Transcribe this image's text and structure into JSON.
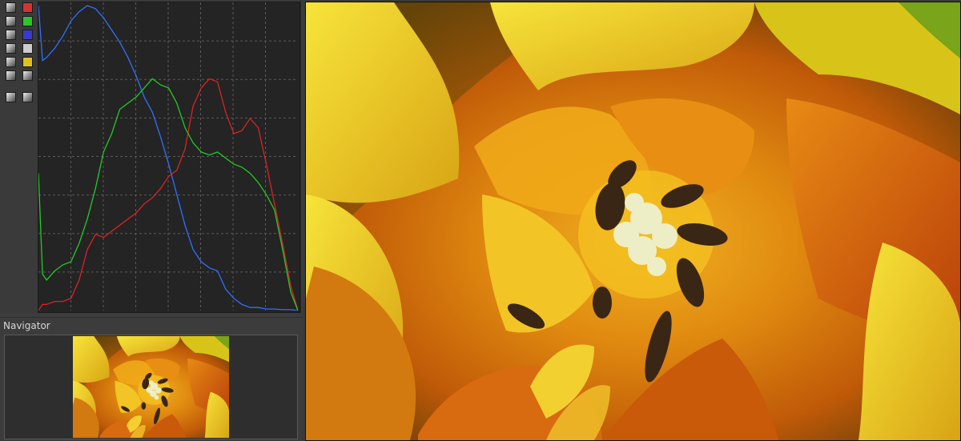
{
  "navigator": {
    "title": "Navigator"
  },
  "histogram": {
    "toolbar_buttons": [
      {
        "name": "histogram-full-icon"
      },
      {
        "name": "red-channel-toggle",
        "color": "#d63232"
      },
      {
        "name": "rgb-bar-icon"
      },
      {
        "name": "green-channel-toggle",
        "color": "#2ec42e"
      },
      {
        "name": "chroma-icon"
      },
      {
        "name": "blue-channel-toggle",
        "color": "#3a3ad0"
      },
      {
        "name": "luminance-curve-icon"
      },
      {
        "name": "luminance-toggle",
        "color": "#cccccc"
      },
      {
        "name": "raw-histogram-icon"
      },
      {
        "name": "chromaticity-toggle",
        "color": "#e0c020"
      },
      {
        "name": "crosshair-icon"
      },
      {
        "name": "gradient-icon"
      },
      {
        "name": "expand-icon"
      },
      {
        "name": "bar-display-icon"
      }
    ]
  },
  "chart_data": {
    "type": "line",
    "title": "",
    "xlabel": "",
    "ylabel": "",
    "xlim": [
      0,
      255
    ],
    "ylim": [
      0,
      100
    ],
    "grid": true,
    "x": [
      0,
      4,
      8,
      16,
      24,
      32,
      40,
      48,
      56,
      64,
      72,
      80,
      88,
      96,
      104,
      112,
      120,
      128,
      136,
      144,
      152,
      160,
      168,
      176,
      184,
      192,
      200,
      208,
      216,
      224,
      232,
      240,
      248,
      255
    ],
    "series": [
      {
        "color": "#3070ff",
        "values": [
          100,
          82,
          83,
          86,
          90,
          95,
          98,
          100,
          99,
          96,
          92,
          88,
          83,
          77,
          70,
          65,
          57,
          48,
          38,
          28,
          20,
          16,
          14,
          13,
          7,
          4,
          2,
          1,
          1,
          0.5,
          0.5,
          0.3,
          0.3,
          0
        ]
      },
      {
        "color": "#dd2222",
        "values": [
          0,
          2,
          2,
          3,
          3,
          4,
          10,
          20,
          25,
          24,
          26,
          28,
          30,
          32,
          35,
          37,
          40,
          44,
          46,
          53,
          67,
          73,
          76,
          75,
          65,
          58,
          59,
          63,
          60,
          48,
          35,
          22,
          8,
          0
        ]
      },
      {
        "color": "#22cc22",
        "values": [
          45,
          12,
          10,
          13,
          15,
          16,
          22,
          30,
          40,
          52,
          58,
          66,
          68,
          70,
          73,
          76,
          74,
          73,
          68,
          60,
          55,
          52,
          51,
          52,
          50,
          48,
          47,
          45,
          42,
          38,
          33,
          20,
          6,
          0
        ]
      }
    ]
  }
}
